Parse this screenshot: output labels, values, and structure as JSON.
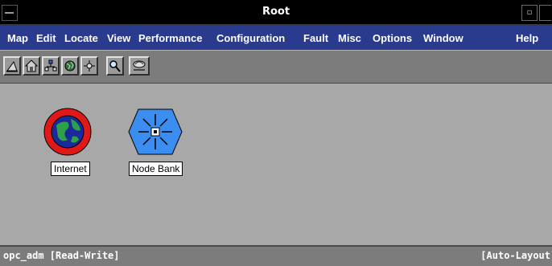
{
  "window": {
    "title": "Root",
    "system_menu_icon": "system-menu-icon",
    "minimize_glyph": "▫"
  },
  "menu": {
    "items": [
      {
        "label": "Map"
      },
      {
        "label": "Edit"
      },
      {
        "label": "Locate"
      },
      {
        "label": "View"
      },
      {
        "label": "Performance"
      },
      {
        "label": "Configuration"
      },
      {
        "label": "Fault"
      },
      {
        "label": "Misc"
      },
      {
        "label": "Options"
      },
      {
        "label": "Window"
      },
      {
        "label": "Help"
      }
    ]
  },
  "toolbar": {
    "icons": [
      "triangle-icon",
      "home-icon",
      "network-tree-icon",
      "globe-icon",
      "compass-icon",
      "search-icon",
      "submap-icon"
    ]
  },
  "canvas": {
    "nodes": [
      {
        "label": "Internet",
        "icon": "internet-globe-icon"
      },
      {
        "label": "Node Bank",
        "icon": "node-bank-icon"
      }
    ]
  },
  "status": {
    "left": "opc_adm [Read-Write]",
    "right": "[Auto-Layout"
  },
  "colors": {
    "menubar": "#2a3b8e",
    "canvas": "#a8a8a8",
    "internet_ring": "#e01818",
    "node_bank": "#3b8ef0"
  }
}
